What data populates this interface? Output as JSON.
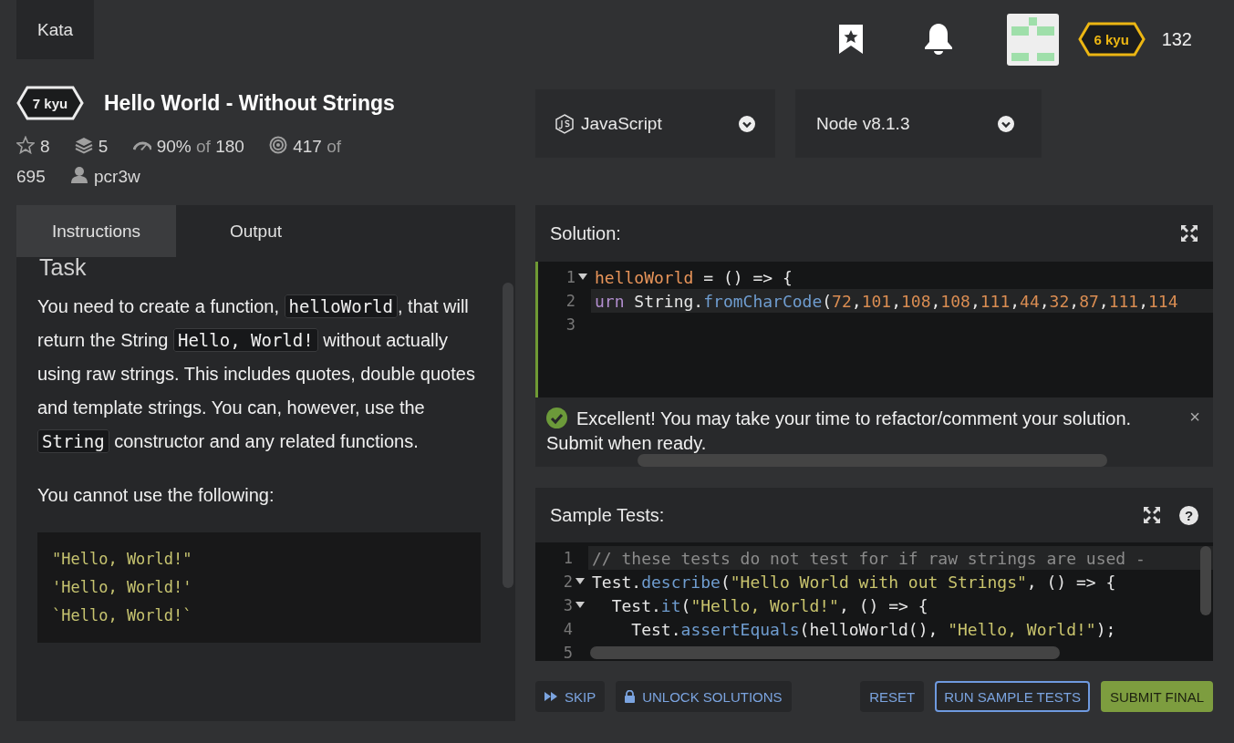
{
  "nav": {
    "section": "Kata"
  },
  "user": {
    "rank": "6 kyu",
    "honor": "132"
  },
  "kata": {
    "rank": "7 kyu",
    "title": "Hello World - Without Strings",
    "stats": [
      {
        "kind": "stars",
        "value": "8"
      },
      {
        "kind": "collections",
        "value": "5"
      },
      {
        "kind": "satisfaction",
        "value": "90%",
        "of": "of",
        "total": "180"
      },
      {
        "kind": "completed",
        "value": "417",
        "of": "of",
        "total": "695"
      },
      {
        "kind": "author",
        "value": "pcr3w"
      }
    ]
  },
  "tabs": [
    {
      "label": "Instructions",
      "selected": true
    },
    {
      "label": "Output",
      "selected": false
    }
  ],
  "instructions": {
    "heading": "Task",
    "paragraphs": [
      [
        {
          "text": "You need to create a function, ",
          "code": false
        },
        {
          "text": "helloWorld",
          "code": true
        },
        {
          "text": ", that will return the String ",
          "code": false
        },
        {
          "text": "Hello, World!",
          "code": true
        },
        {
          "text": " without actually using raw strings. This includes quotes, double quotes and template strings. You can, however, use the ",
          "code": false
        },
        {
          "text": "String",
          "code": true
        },
        {
          "text": " constructor and any related functions.",
          "code": false
        }
      ],
      [
        {
          "text": "You cannot use the following:",
          "code": false
        }
      ]
    ],
    "code_block": [
      "\"Hello, World!\"",
      "'Hello, World!'",
      "`Hello, World!`"
    ]
  },
  "selects": [
    {
      "kind": "language",
      "value": "JavaScript"
    },
    {
      "kind": "version",
      "value": "Node v8.1.3"
    }
  ],
  "solution": {
    "title": "Solution:",
    "lines": [
      {
        "number": "1",
        "foldable": true,
        "active": false,
        "tokens": [
          {
            "kind": "var",
            "text": "helloWorld"
          },
          {
            "kind": "plain",
            "text": " = () => {"
          }
        ]
      },
      {
        "number": "2",
        "foldable": false,
        "active": true,
        "tokens": [
          {
            "kind": "keyword",
            "text": "urn"
          },
          {
            "kind": "plain",
            "text": " String."
          },
          {
            "kind": "fn",
            "text": "fromCharCode"
          },
          {
            "kind": "plain",
            "text": "("
          },
          {
            "kind": "num",
            "text": "72"
          },
          {
            "kind": "plain",
            "text": ","
          },
          {
            "kind": "num",
            "text": "101"
          },
          {
            "kind": "plain",
            "text": ","
          },
          {
            "kind": "num",
            "text": "108"
          },
          {
            "kind": "plain",
            "text": ","
          },
          {
            "kind": "num",
            "text": "108"
          },
          {
            "kind": "plain",
            "text": ","
          },
          {
            "kind": "num",
            "text": "111"
          },
          {
            "kind": "plain",
            "text": ","
          },
          {
            "kind": "num",
            "text": "44"
          },
          {
            "kind": "plain",
            "text": ","
          },
          {
            "kind": "num",
            "text": "32"
          },
          {
            "kind": "plain",
            "text": ","
          },
          {
            "kind": "num",
            "text": "87"
          },
          {
            "kind": "plain",
            "text": ","
          },
          {
            "kind": "num",
            "text": "111"
          },
          {
            "kind": "plain",
            "text": ","
          },
          {
            "kind": "num",
            "text": "114"
          }
        ]
      },
      {
        "number": "3",
        "foldable": false,
        "active": false
      }
    ],
    "message": "Excellent! You may take your time to refactor/comment your solution. Submit when ready.",
    "close": "×"
  },
  "sample_tests": {
    "title": "Sample Tests:",
    "lines": [
      {
        "number": "1",
        "foldable": false,
        "active": true,
        "tokens": [
          {
            "kind": "comment",
            "text": "// these tests do not test for if raw strings are used -"
          }
        ]
      },
      {
        "number": "2",
        "foldable": true,
        "active": false,
        "tokens": [
          {
            "kind": "plain",
            "text": "Test."
          },
          {
            "kind": "fn",
            "text": "describe"
          },
          {
            "kind": "plain",
            "text": "("
          },
          {
            "kind": "str",
            "text": "\"Hello World with out Strings\""
          },
          {
            "kind": "plain",
            "text": ", () => {"
          }
        ]
      },
      {
        "number": "3",
        "foldable": true,
        "active": false,
        "tokens": [
          {
            "kind": "plain",
            "text": "  Test."
          },
          {
            "kind": "fn",
            "text": "it"
          },
          {
            "kind": "plain",
            "text": "("
          },
          {
            "kind": "str",
            "text": "\"Hello, World!\""
          },
          {
            "kind": "plain",
            "text": ", () => {"
          }
        ]
      },
      {
        "number": "4",
        "foldable": false,
        "active": false,
        "tokens": [
          {
            "kind": "plain",
            "text": "    Test."
          },
          {
            "kind": "fn",
            "text": "assertEquals"
          },
          {
            "kind": "plain",
            "text": "(helloWorld(), "
          },
          {
            "kind": "str",
            "text": "\"Hello, World!\""
          },
          {
            "kind": "plain",
            "text": ");"
          }
        ]
      },
      {
        "number": "5",
        "foldable": false,
        "active": false
      }
    ],
    "help": "?"
  },
  "actions_left": [
    {
      "kind": "skip",
      "label": "SKIP"
    },
    {
      "kind": "unlock",
      "label": "UNLOCK SOLUTIONS"
    }
  ],
  "actions_right": [
    {
      "kind": "plain",
      "label": "RESET"
    },
    {
      "kind": "outline",
      "label": "RUN SAMPLE TESTS"
    },
    {
      "kind": "primary",
      "label": "SUBMIT FINAL"
    }
  ]
}
